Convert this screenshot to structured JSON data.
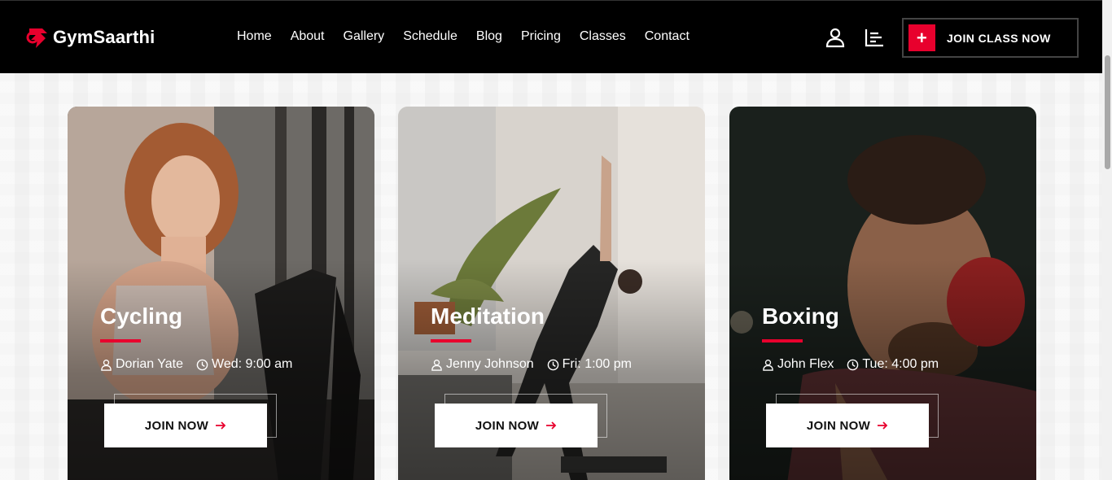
{
  "brand": {
    "name": "GymSaarthi",
    "accent": "#e8002d"
  },
  "nav": {
    "links": [
      "Home",
      "About",
      "Gallery",
      "Schedule",
      "Blog",
      "Pricing",
      "Classes",
      "Contact"
    ],
    "cta_label": "JOIN CLASS NOW",
    "icons": [
      "user-icon",
      "menu-bars-icon"
    ]
  },
  "cards": [
    {
      "title": "Cycling",
      "trainer": "Dorian Yate",
      "time": "Wed: 9:00 am",
      "button": "JOIN NOW"
    },
    {
      "title": "Meditation",
      "trainer": "Jenny Johnson",
      "time": "Fri: 1:00 pm",
      "button": "JOIN NOW"
    },
    {
      "title": "Boxing",
      "trainer": "John Flex",
      "time": "Tue: 4:00 pm",
      "button": "JOIN NOW"
    }
  ]
}
